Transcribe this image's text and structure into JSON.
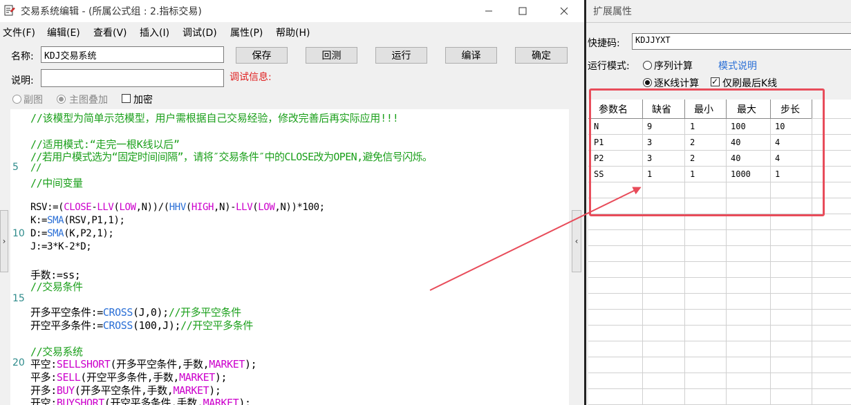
{
  "editor_window": {
    "title": "交易系统编辑 - (所属公式组 : 2.指标交易)",
    "menu": [
      "文件(F)",
      "编辑(E)",
      "查看(V)",
      "插入(I)",
      "调试(D)",
      "属性(P)",
      "帮助(H)"
    ],
    "name_label": "名称:",
    "name_value": "KDJ交易系统",
    "desc_label": "说明:",
    "desc_value": "",
    "debug_label": "调试信息:",
    "buttons": [
      "保存",
      "回测",
      "运行",
      "编译",
      "确定"
    ],
    "options": {
      "sub_chart": "副图",
      "main_overlay": "主图叠加",
      "encrypt": "加密"
    },
    "line_numbers": [
      "5",
      "10",
      "15",
      "20"
    ],
    "code_lines": [
      "//该模型为简单示范模型，用户需根据自己交易经验，修改完善后再实际应用!!!",
      "",
      "//适用模式:“走完一根K线以后”",
      "//若用户模式选为“固定时间间隔”，请将″交易条件″中的CLOSE改为OPEN,避免信号闪烁。",
      "//",
      "//中间变量",
      "",
      "RSV:=(CLOSE-LLV(LOW,N))/(HHV(HIGH,N)-LLV(LOW,N))*100;",
      "K:=SMA(RSV,P1,1);",
      "D:=SMA(K,P2,1);",
      "J:=3*K-2*D;",
      "",
      "手数:=ss;",
      "//交易条件",
      "",
      "开多平空条件:=CROSS(J,0);//开多平空条件",
      "开空平多条件:=CROSS(100,J);//开空平多条件",
      "",
      "//交易系统",
      "平空:SELLSHORT(开多平空条件,手数,MARKET);",
      "平多:SELL(开空平多条件,手数,MARKET);",
      "开多:BUY(开多平空条件,手数,MARKET);",
      "开空:BUYSHORT(开空平多条件,手数,MARKET);"
    ]
  },
  "properties_panel": {
    "title": "扩展属性",
    "shortcut_label": "快捷码:",
    "shortcut_value": "KDJJYXT",
    "mode_label": "运行模式:",
    "mode_sequence": "序列计算",
    "mode_help": "模式说明",
    "mode_per_bar": "逐K线计算",
    "refresh_last_only": "仅刷最后K线",
    "param_headers": [
      "参数名",
      "缺省",
      "最小",
      "最大",
      "步长"
    ],
    "params": [
      [
        "N",
        "9",
        "1",
        "100",
        "10"
      ],
      [
        "P1",
        "3",
        "2",
        "40",
        "4"
      ],
      [
        "P2",
        "3",
        "2",
        "40",
        "4"
      ],
      [
        "SS",
        "1",
        "1",
        "1000",
        "1"
      ]
    ]
  },
  "colors": {
    "highlight_rect": "#e84c5a",
    "comment": "#1a9f1a",
    "function": "#cc00cc",
    "keyword": "#2a6fd6",
    "debug_label": "#e02020"
  }
}
